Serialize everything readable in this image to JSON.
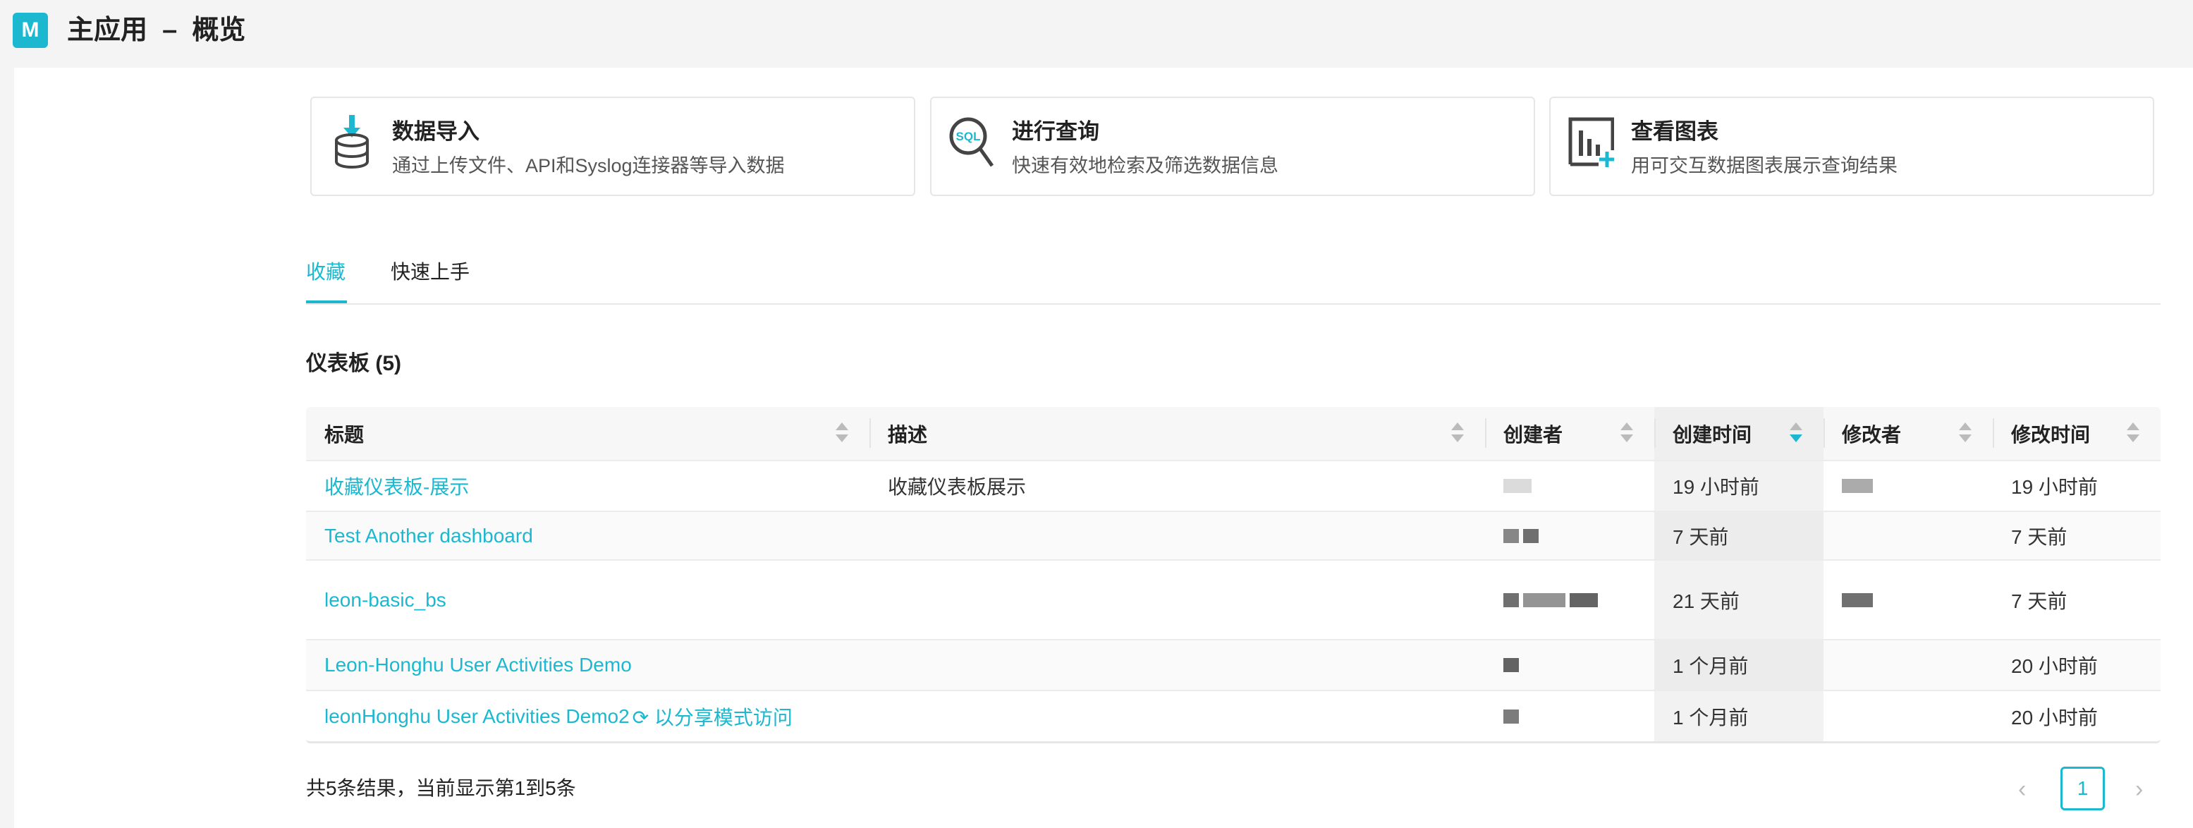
{
  "header": {
    "logo_letter": "M",
    "title": "主应用  –  概览"
  },
  "cards": [
    {
      "title": "数据导入",
      "desc": "通过上传文件、API和Syslog连接器等导入数据",
      "icon": "database-import-icon"
    },
    {
      "title": "进行查询",
      "desc": "快速有效地检索及筛选数据信息",
      "icon": "sql-search-icon",
      "icon_text": "SQL"
    },
    {
      "title": "查看图表",
      "desc": "用可交互数据图表展示查询结果",
      "icon": "chart-add-icon"
    }
  ],
  "tabs": [
    {
      "label": "收藏",
      "active": true
    },
    {
      "label": "快速上手",
      "active": false
    }
  ],
  "section_title": "仪表板 (5)",
  "table": {
    "columns": [
      "标题",
      "描述",
      "创建者",
      "创建时间",
      "修改者",
      "修改时间"
    ],
    "sorted_column": "创建时间",
    "sort_direction": "desc",
    "rows": [
      {
        "title": "收藏仪表板-展示",
        "desc": "收藏仪表板展示",
        "created": "19 小时前",
        "modified": "19 小时前"
      },
      {
        "title": "Test Another dashboard",
        "desc": "",
        "created": "7 天前",
        "modified": "7 天前"
      },
      {
        "title": "leon-basic_bs",
        "desc": "",
        "created": "21 天前",
        "modified": "7 天前"
      },
      {
        "title": "Leon-Honghu User Activities Demo",
        "desc": "",
        "created": "1 个月前",
        "modified": "20 小时前"
      },
      {
        "title": "leonHonghu User Activities Demo2",
        "share_label": "以分享模式访问",
        "desc": "",
        "created": "1 个月前",
        "modified": "20 小时前"
      }
    ]
  },
  "footer": {
    "summary": "共5条结果，当前显示第1到5条",
    "current_page": "1",
    "prev": "‹",
    "next": "›"
  },
  "colors": {
    "accent": "#1bb8d0"
  }
}
